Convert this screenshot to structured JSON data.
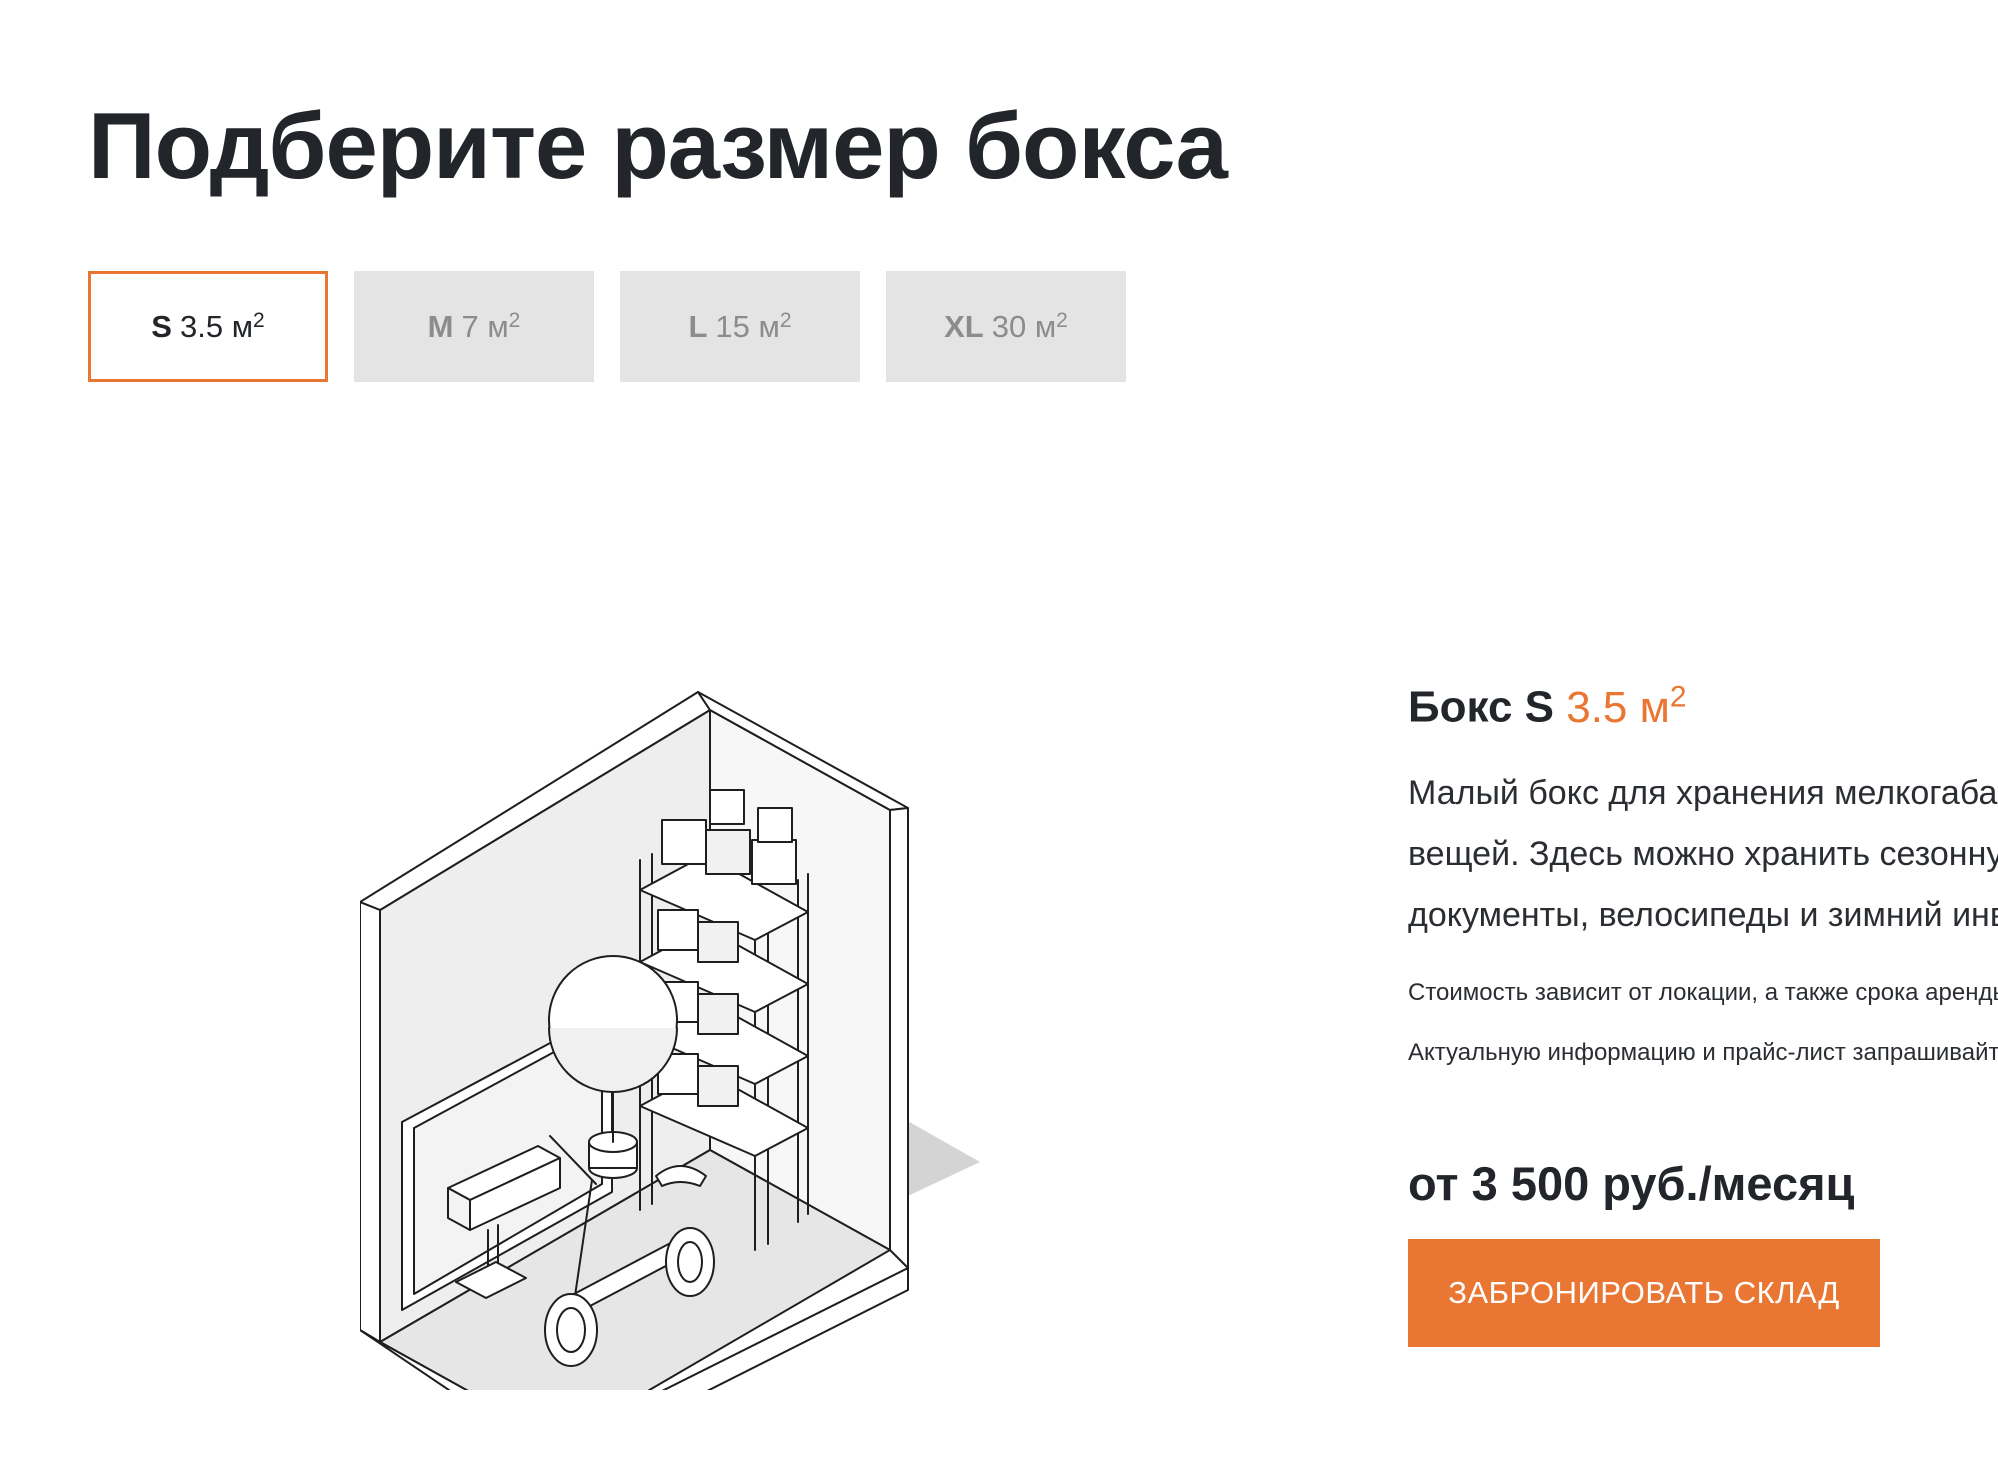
{
  "header": {
    "title": "Подберите размер бокса"
  },
  "tabs": [
    {
      "size": "S",
      "area": "3.5 м",
      "sup": "2",
      "active": true
    },
    {
      "size": "M",
      "area": "7 м",
      "sup": "2",
      "active": false
    },
    {
      "size": "L",
      "area": "15 м",
      "sup": "2",
      "active": false
    },
    {
      "size": "XL",
      "area": "30 м",
      "sup": "2",
      "active": false
    }
  ],
  "details": {
    "heading_prefix": "Бокс S",
    "heading_area": "3.5 м",
    "heading_sup": "2",
    "description": "Малый бокс для хранения мелкогабаритных вещей. Здесь можно хранить сезонную резину, документы, велосипеды и зимний инвентарь.",
    "note_1": "Стоимость зависит от локации, а также срока аренды.",
    "note_2": "Актуальную информацию и прайс-лист запрашивайте у менеджера.",
    "price": "от 3 500 руб./месяц",
    "book_label": "ЗАБРОНИРОВАТЬ СКЛАД"
  },
  "illustration": {
    "icon": "storage-box-illustration-icon"
  },
  "colors": {
    "accent": "#e97632",
    "text": "#22252a",
    "tab_inactive_bg": "#e4e4e4",
    "tab_inactive_text": "#8c8c8c"
  }
}
